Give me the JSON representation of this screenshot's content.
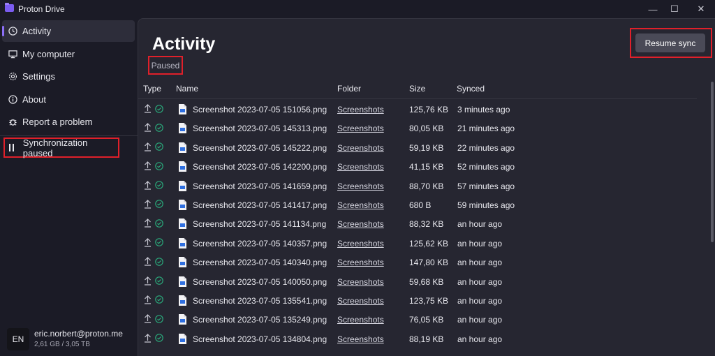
{
  "window": {
    "title": "Proton Drive",
    "controls": {
      "minimize": "—",
      "maximize": "☐",
      "close": "✕"
    }
  },
  "sidebar": {
    "items": [
      {
        "label": "Activity",
        "icon": "clock-icon",
        "active": true
      },
      {
        "label": "My computer",
        "icon": "monitor-icon",
        "active": false
      },
      {
        "label": "Settings",
        "icon": "gear-icon",
        "active": false
      },
      {
        "label": "About",
        "icon": "info-icon",
        "active": false
      },
      {
        "label": "Report a problem",
        "icon": "bug-icon",
        "active": false
      }
    ],
    "sync_status": "Synchronization paused",
    "account": {
      "initials": "EN",
      "email": "eric.norbert@proton.me",
      "storage": "2,61 GB / 3,05 TB"
    }
  },
  "main": {
    "title": "Activity",
    "status": "Paused",
    "resume_button": "Resume sync",
    "columns": {
      "type": "Type",
      "name": "Name",
      "folder": "Folder",
      "size": "Size",
      "synced": "Synced"
    },
    "rows": [
      {
        "name": "Screenshot 2023-07-05 151056.png",
        "folder": "Screenshots",
        "size": "125,76 KB",
        "synced": "3 minutes ago"
      },
      {
        "name": "Screenshot 2023-07-05 145313.png",
        "folder": "Screenshots",
        "size": "80,05 KB",
        "synced": "21 minutes ago"
      },
      {
        "name": "Screenshot 2023-07-05 145222.png",
        "folder": "Screenshots",
        "size": "59,19 KB",
        "synced": "22 minutes ago"
      },
      {
        "name": "Screenshot 2023-07-05 142200.png",
        "folder": "Screenshots",
        "size": "41,15 KB",
        "synced": "52 minutes ago"
      },
      {
        "name": "Screenshot 2023-07-05 141659.png",
        "folder": "Screenshots",
        "size": "88,70 KB",
        "synced": "57 minutes ago"
      },
      {
        "name": "Screenshot 2023-07-05 141417.png",
        "folder": "Screenshots",
        "size": "680 B",
        "synced": "59 minutes ago"
      },
      {
        "name": "Screenshot 2023-07-05 141134.png",
        "folder": "Screenshots",
        "size": "88,32 KB",
        "synced": "an hour ago"
      },
      {
        "name": "Screenshot 2023-07-05 140357.png",
        "folder": "Screenshots",
        "size": "125,62 KB",
        "synced": "an hour ago"
      },
      {
        "name": "Screenshot 2023-07-05 140340.png",
        "folder": "Screenshots",
        "size": "147,80 KB",
        "synced": "an hour ago"
      },
      {
        "name": "Screenshot 2023-07-05 140050.png",
        "folder": "Screenshots",
        "size": "59,68 KB",
        "synced": "an hour ago"
      },
      {
        "name": "Screenshot 2023-07-05 135541.png",
        "folder": "Screenshots",
        "size": "123,75 KB",
        "synced": "an hour ago"
      },
      {
        "name": "Screenshot 2023-07-05 135249.png",
        "folder": "Screenshots",
        "size": "76,05 KB",
        "synced": "an hour ago"
      },
      {
        "name": "Screenshot 2023-07-05 134804.png",
        "folder": "Screenshots",
        "size": "88,19 KB",
        "synced": "an hour ago"
      }
    ]
  },
  "colors": {
    "accent": "#8c6ff7",
    "highlight_border": "#e0202a",
    "success": "#2aa87a",
    "file_icon": "#2f6fe0"
  }
}
